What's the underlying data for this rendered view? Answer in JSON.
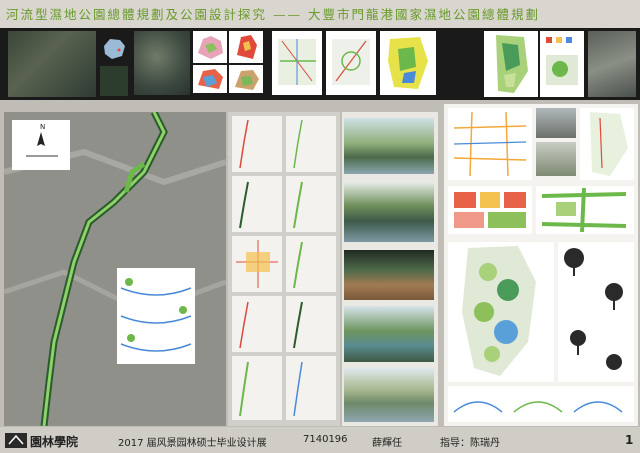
{
  "title": "河流型濕地公園總體規劃及公園設計探究 —— 大豐市門龍港國家濕地公園總體規劃",
  "footer": {
    "school_name": "園林學院",
    "exhibition": "2017 届风景园林硕士毕业设计展",
    "student_id": "7140196",
    "author": "薛輝任",
    "advisor": "指导：陈瑞丹",
    "page_number": "1"
  },
  "colors": {
    "title_green": "#6a9a2a",
    "title_bar": "#d8d6cf",
    "top_band": "#1a1a1a",
    "footer_bar": "#cfcdc6"
  },
  "compass": {
    "north_label": "N"
  }
}
